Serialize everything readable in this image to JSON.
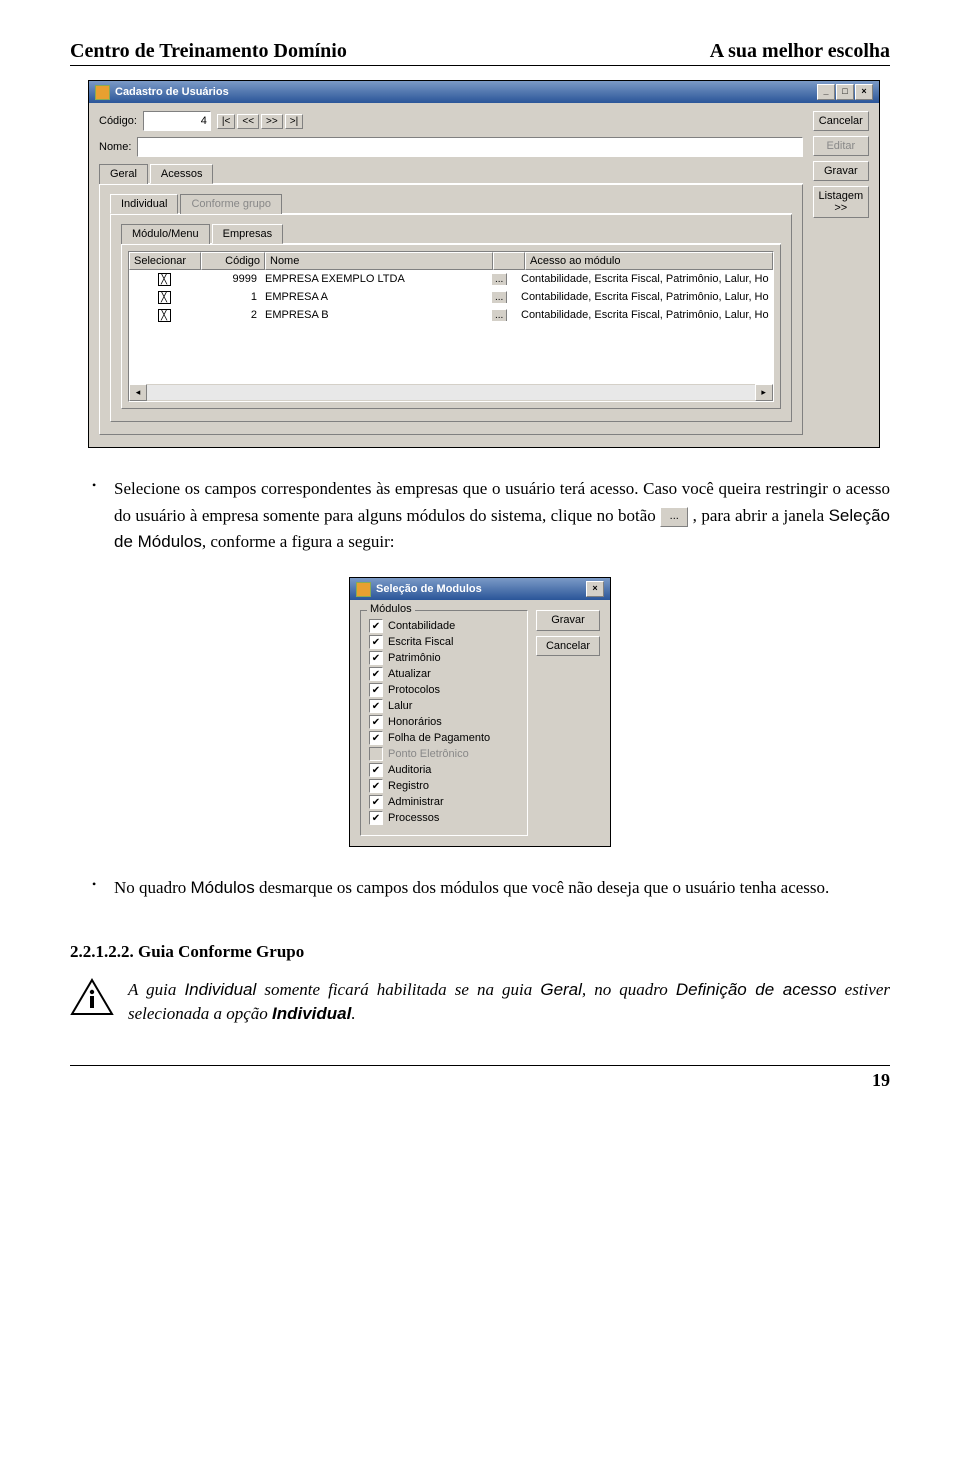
{
  "header": {
    "left": "Centro de Treinamento Domínio",
    "right": "A sua melhor escolha"
  },
  "win1": {
    "title": "Cadastro de Usuários",
    "codigo_label": "Código:",
    "codigo_value": "4",
    "nome_label": "Nome:",
    "nome_value": "",
    "nav": [
      "|<",
      "<<",
      ">>",
      ">|"
    ],
    "btns": {
      "cancelar": "Cancelar",
      "editar": "Editar",
      "gravar": "Gravar",
      "listagem": "Listagem >>"
    },
    "tabs1": [
      "Geral",
      "Acessos"
    ],
    "tabs2": [
      "Individual",
      "Conforme grupo"
    ],
    "tabs3": [
      "Módulo/Menu",
      "Empresas"
    ],
    "cols": {
      "sel": "Selecionar",
      "cod": "Código",
      "nome": "Nome",
      "acesso": "Acesso ao módulo"
    },
    "rows": [
      {
        "sel": true,
        "cod": "9999",
        "nome": "EMPRESA EXEMPLO LTDA",
        "acesso": "Contabilidade, Escrita Fiscal, Patrimônio, Lalur, Ho"
      },
      {
        "sel": true,
        "cod": "1",
        "nome": "EMPRESA A",
        "acesso": "Contabilidade, Escrita Fiscal, Patrimônio, Lalur, Ho"
      },
      {
        "sel": true,
        "cod": "2",
        "nome": "EMPRESA B",
        "acesso": "Contabilidade, Escrita Fiscal, Patrimônio, Lalur, Ho"
      }
    ]
  },
  "para1": {
    "a": "Selecione os campos correspondentes às empresas que o usuário terá acesso. Caso você queira restringir o acesso do usuário à empresa somente para alguns módulos do sistema, clique no botão ",
    "b": " , para abrir a janela ",
    "c": "Seleção de Módulos",
    "d": ", conforme a figura a seguir:"
  },
  "ellipsis": "...",
  "win2": {
    "title": "Seleção de Modulos",
    "legend": "Módulos",
    "btn_gravar": "Gravar",
    "btn_cancelar": "Cancelar",
    "items": [
      {
        "label": "Contabilidade",
        "checked": true,
        "disabled": false
      },
      {
        "label": "Escrita Fiscal",
        "checked": true,
        "disabled": false
      },
      {
        "label": "Patrimônio",
        "checked": true,
        "disabled": false
      },
      {
        "label": "Atualizar",
        "checked": true,
        "disabled": false
      },
      {
        "label": "Protocolos",
        "checked": true,
        "disabled": false
      },
      {
        "label": "Lalur",
        "checked": true,
        "disabled": false
      },
      {
        "label": "Honorários",
        "checked": true,
        "disabled": false
      },
      {
        "label": "Folha de Pagamento",
        "checked": true,
        "disabled": false
      },
      {
        "label": "Ponto Eletrônico",
        "checked": false,
        "disabled": true
      },
      {
        "label": "Auditoria",
        "checked": true,
        "disabled": false
      },
      {
        "label": "Registro",
        "checked": true,
        "disabled": false
      },
      {
        "label": "Administrar",
        "checked": true,
        "disabled": false
      },
      {
        "label": "Processos",
        "checked": true,
        "disabled": false
      }
    ]
  },
  "para2": {
    "a": "No quadro ",
    "b": "Módulos",
    "c": " desmarque os campos dos módulos que você não deseja que o usuário tenha acesso."
  },
  "sec_title": "2.2.1.2.2. Guia Conforme Grupo",
  "note": {
    "a": "A guia ",
    "b": "Individual",
    "c": " somente ficará habilitada se na guia ",
    "d": "Geral",
    "e": ", no quadro ",
    "f": "Definição de acesso",
    "g": " estiver selecionada a opção ",
    "h": "Individual",
    "i": "."
  },
  "page_number": "19"
}
